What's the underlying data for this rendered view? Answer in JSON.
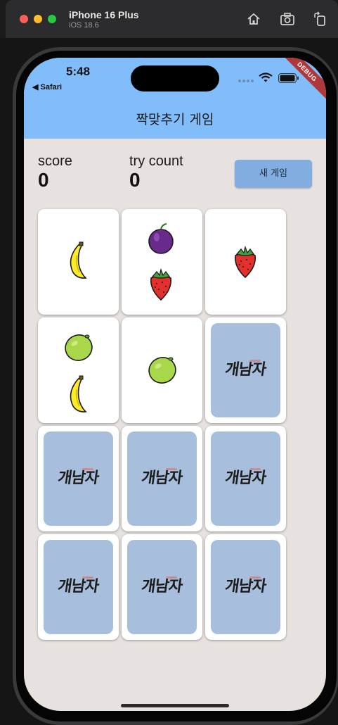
{
  "simulator": {
    "device_name": "iPhone 16 Plus",
    "os_version": "iOS 18.6",
    "toolbar_icons": [
      "home-icon",
      "screenshot-icon",
      "rotate-icon"
    ]
  },
  "status_bar": {
    "time": "5:48",
    "back_link": "◀ Safari"
  },
  "debug_banner": "DEBUG",
  "app_bar": {
    "title": "짝맞추기 게임"
  },
  "scoreboard": {
    "score_label": "score",
    "score_value": "0",
    "try_label": "try count",
    "try_value": "0",
    "new_game_label": "새 게임"
  },
  "cards": [
    {
      "state": "face-up",
      "fruits": [
        "banana"
      ]
    },
    {
      "state": "face-up",
      "fruits": [
        "plum",
        "strawberry"
      ]
    },
    {
      "state": "face-up",
      "fruits": [
        "strawberry"
      ]
    },
    {
      "state": "face-up",
      "fruits": [
        "lime",
        "banana"
      ]
    },
    {
      "state": "face-up",
      "fruits": [
        "lime"
      ]
    },
    {
      "state": "face-down",
      "logo": "개남자"
    },
    {
      "state": "face-down",
      "logo": "개남자"
    },
    {
      "state": "face-down",
      "logo": "개남자"
    },
    {
      "state": "face-down",
      "logo": "개남자"
    },
    {
      "state": "face-down",
      "logo": "개남자"
    },
    {
      "state": "face-down",
      "logo": "개남자"
    },
    {
      "state": "face-down",
      "logo": "개남자"
    }
  ],
  "colors": {
    "app_bar": "#82bdfb",
    "background": "#e7e2df",
    "button": "#82ade0",
    "card_back": "#a7bfdc",
    "debug_ribbon": "#b0373b"
  }
}
